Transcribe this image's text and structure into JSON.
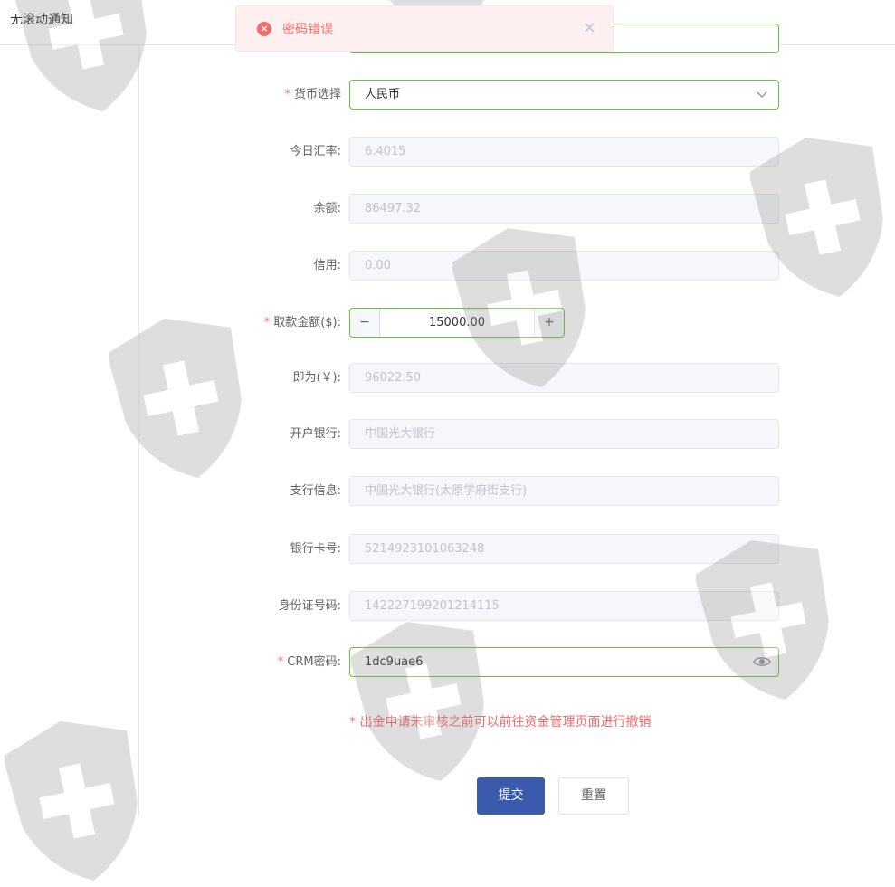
{
  "header": {
    "title": "无滚动通知"
  },
  "toast": {
    "message": "密码错误",
    "close_symbol": "×",
    "error_symbol": "×"
  },
  "form": {
    "currency": {
      "label": "货币选择",
      "value": "人民币",
      "required": true
    },
    "exchange_rate": {
      "label": "今日汇率:",
      "value": "6.4015"
    },
    "balance": {
      "label": "余额:",
      "value": "86497.32"
    },
    "credit": {
      "label": "信用:",
      "value": "0.00"
    },
    "withdraw_amount": {
      "label": "取款金额($):",
      "value": "15000.00",
      "minus": "−",
      "plus": "+",
      "required": true
    },
    "equivalent": {
      "label": "即为(￥):",
      "value": "96022.50"
    },
    "bank": {
      "label": "开户银行:",
      "value": "中国光大银行"
    },
    "branch": {
      "label": "支行信息:",
      "value": "中国光大银行(太原学府街支行)"
    },
    "card_number": {
      "label": "银行卡号:",
      "value": "5214923101063248"
    },
    "id_number": {
      "label": "身份证号码:",
      "value": "142227199201214115"
    },
    "crm_password": {
      "label": "CRM密码:",
      "value": "1dc9uae6",
      "required": true
    }
  },
  "required_mark": "*",
  "notice": "* 出金申请未审核之前可以前往资金管理页面进行撤销",
  "buttons": {
    "submit": "提交",
    "reset": "重置"
  },
  "colors": {
    "primary": "#3a5bac",
    "error": "#f56c6c",
    "success": "#67c23a"
  }
}
